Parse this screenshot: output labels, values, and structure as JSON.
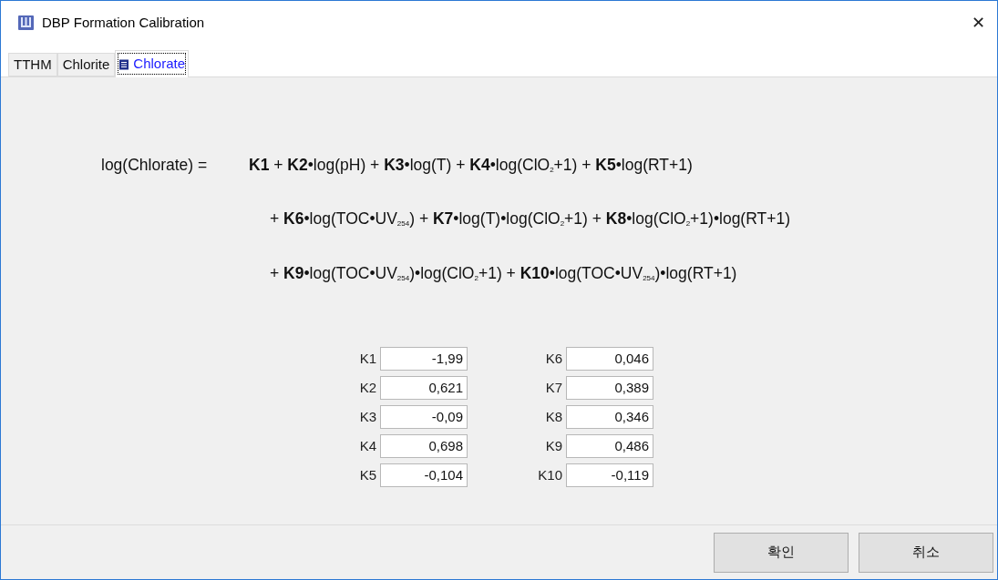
{
  "window": {
    "title": "DBP Formation Calibration",
    "close": "✕"
  },
  "tabs": [
    {
      "label": "TTHM",
      "selected": false
    },
    {
      "label": "Chlorite",
      "selected": false
    },
    {
      "label": "Chlorate",
      "selected": true
    }
  ],
  "equation": {
    "lhs": "log(Chlorate) =",
    "lines": [
      "**K1** + **K2**•log(pH) + **K3**•log(T) + **K4**•log(ClO$_{2}$+1) + **K5**•log(RT+1)",
      "+ **K6**•log(TOC•UV$_{254}$) + **K7**•log(T)•log(ClO$_{2}$+1) + **K8**•log(ClO$_{2}$+1)•log(RT+1)",
      "+ **K9**•log(TOC•UV$_{254}$)•log(ClO$_{2}$+1) + **K10**•log(TOC•UV$_{254}$)•log(RT+1)"
    ]
  },
  "coefficients": [
    {
      "label": "K1",
      "value": "-1,99"
    },
    {
      "label": "K2",
      "value": "0,621"
    },
    {
      "label": "K3",
      "value": "-0,09"
    },
    {
      "label": "K4",
      "value": "0,698"
    },
    {
      "label": "K5",
      "value": "-0,104"
    },
    {
      "label": "K6",
      "value": "0,046"
    },
    {
      "label": "K7",
      "value": "0,389"
    },
    {
      "label": "K8",
      "value": "0,346"
    },
    {
      "label": "K9",
      "value": "0,486"
    },
    {
      "label": "K10",
      "value": "-0,119"
    }
  ],
  "buttons": [
    "확인",
    "취소"
  ]
}
